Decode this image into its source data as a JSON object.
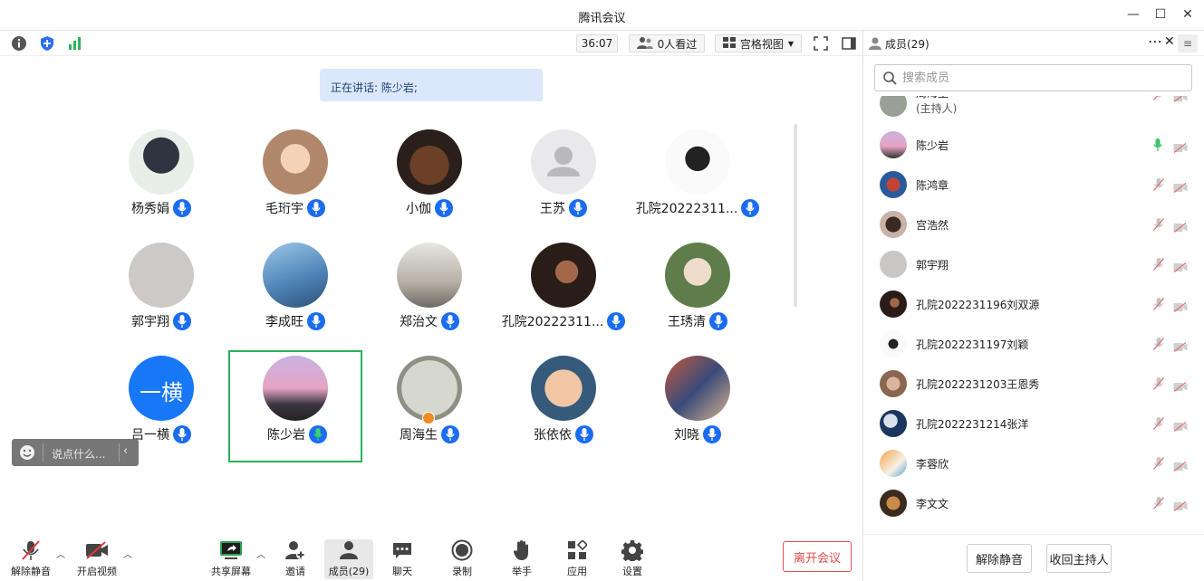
{
  "window": {
    "title": "腾讯会议"
  },
  "toolbar": {
    "timer": "36:07",
    "viewers": "0人看过",
    "view_mode": "宫格视图"
  },
  "speaking": {
    "text": "正在讲话: 陈少岩;"
  },
  "participants": [
    {
      "name": "杨秀娟",
      "mic": "blue"
    },
    {
      "name": "毛珩宇",
      "mic": "blue"
    },
    {
      "name": "小伽",
      "mic": "blue"
    },
    {
      "name": "王苏",
      "mic": "blue"
    },
    {
      "name": "孔院20222311...",
      "mic": "blue"
    },
    {
      "name": "郭宇翔",
      "mic": "blue"
    },
    {
      "name": "李成旺",
      "mic": "blue"
    },
    {
      "name": "郑治文",
      "mic": "blue"
    },
    {
      "name": "孔院20222311...",
      "mic": "blue"
    },
    {
      "name": "王琇清",
      "mic": "blue"
    },
    {
      "name": "吕一横",
      "mic": "blue",
      "avatar_text": "一横"
    },
    {
      "name": "陈少岩",
      "mic": "green",
      "active": true
    },
    {
      "name": "周海生",
      "mic": "blue"
    },
    {
      "name": "张依依",
      "mic": "blue"
    },
    {
      "name": "刘晓",
      "mic": "blue"
    }
  ],
  "chat": {
    "placeholder": "说点什么..."
  },
  "bottom_bar": {
    "unmute": "解除静音",
    "start_video": "开启视频",
    "share_screen": "共享屏幕",
    "invite": "邀请",
    "members": "成员(29)",
    "chat": "聊天",
    "record": "录制",
    "raise_hand": "举手",
    "apps": "应用",
    "settings": "设置",
    "leave": "离开会议"
  },
  "panel": {
    "title": "成员(29)",
    "search_placeholder": "搜索成员",
    "members": [
      {
        "name": "周海生",
        "sub": "(主持人)",
        "mic": "muted",
        "partial": true
      },
      {
        "name": "陈少岩",
        "mic": "speaking"
      },
      {
        "name": "陈鸿章",
        "mic": "muted"
      },
      {
        "name": "宫浩然",
        "mic": "muted"
      },
      {
        "name": "郭宇翔",
        "mic": "muted"
      },
      {
        "name": "孔院2022231196刘双源",
        "mic": "muted"
      },
      {
        "name": "孔院2022231197刘颖",
        "mic": "muted"
      },
      {
        "name": "孔院2022231203王恩秀",
        "mic": "muted"
      },
      {
        "name": "孔院2022231214张洋",
        "mic": "muted"
      },
      {
        "name": "李蓉欣",
        "mic": "muted"
      },
      {
        "name": "李文文",
        "mic": "muted"
      }
    ],
    "mute_all": "解除静音",
    "reclaim_host": "收回主持人"
  },
  "colors": {
    "accent": "#1a6cf0",
    "speaking_green": "#27b35a",
    "leave_red": "#e34b4b"
  }
}
